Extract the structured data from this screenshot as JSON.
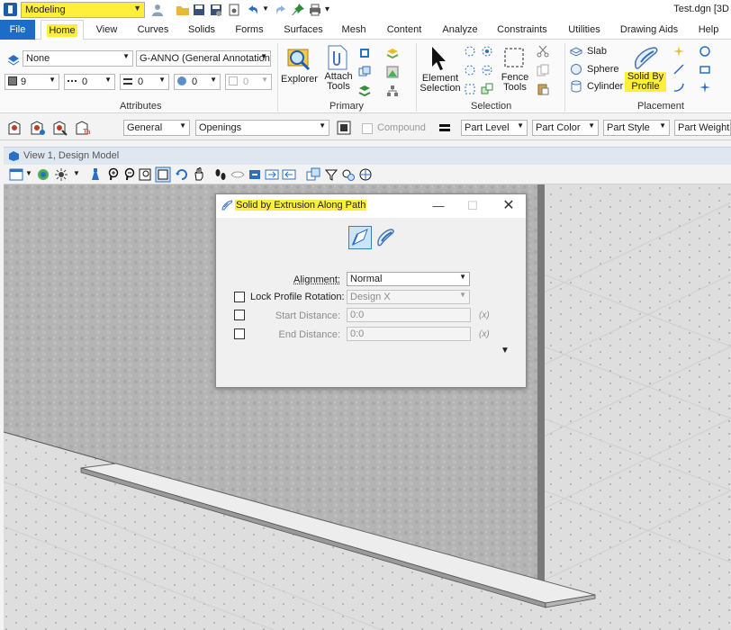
{
  "titlebar": {
    "workflow": "Modeling",
    "document_title": "Test.dgn [3D"
  },
  "tabs": [
    {
      "label": "File"
    },
    {
      "label": "Home",
      "selected": true
    },
    {
      "label": "View"
    },
    {
      "label": "Curves"
    },
    {
      "label": "Solids"
    },
    {
      "label": "Forms"
    },
    {
      "label": "Surfaces"
    },
    {
      "label": "Mesh"
    },
    {
      "label": "Content"
    },
    {
      "label": "Analyze"
    },
    {
      "label": "Constraints"
    },
    {
      "label": "Utilities"
    },
    {
      "label": "Drawing Aids"
    },
    {
      "label": "Help"
    }
  ],
  "ribbon": {
    "attributes": {
      "group_label": "Attributes",
      "active_level": "None",
      "text_style": "G-ANNO (General Annotation",
      "color_value": "9",
      "line_style_value": "0",
      "line_weight_value": "0",
      "transparency_value": "0",
      "priority_value": "0"
    },
    "primary": {
      "group_label": "Primary",
      "explorer_label": "Explorer",
      "attach_tools_label": "Attach Tools"
    },
    "selection": {
      "group_label": "Selection",
      "element_selection_label": "Element Selection",
      "fence_tools_label": "Fence Tools"
    },
    "placement": {
      "group_label": "Placement",
      "slab_label": "Slab",
      "sphere_label": "Sphere",
      "cylinder_label": "Cylinder",
      "solid_by_profile_label": "Solid By Profile"
    }
  },
  "attrbar": {
    "family": "General",
    "part": "Openings",
    "compound_label": "Compound",
    "part_level": "Part Level",
    "part_color": "Part Color",
    "part_style": "Part Style",
    "part_weight": "Part Weight"
  },
  "view": {
    "title": "View 1, Design Model"
  },
  "dialog": {
    "title": "Solid by Extrusion Along Path",
    "alignment_label": "Alignment:",
    "alignment_value": "Normal",
    "lock_rotation_label": "Lock Profile Rotation:",
    "lock_rotation_value": "Design X",
    "start_distance_label": "Start Distance:",
    "start_distance_value": "0:0",
    "end_distance_label": "End Distance:",
    "end_distance_value": "0:0",
    "fx_label": "(x)"
  },
  "colors": {
    "accent_blue": "#1d6cc8",
    "highlight_yellow": "#ffef3a",
    "wall_gray": "#b5b5b5",
    "ground_gray": "#dedede"
  }
}
